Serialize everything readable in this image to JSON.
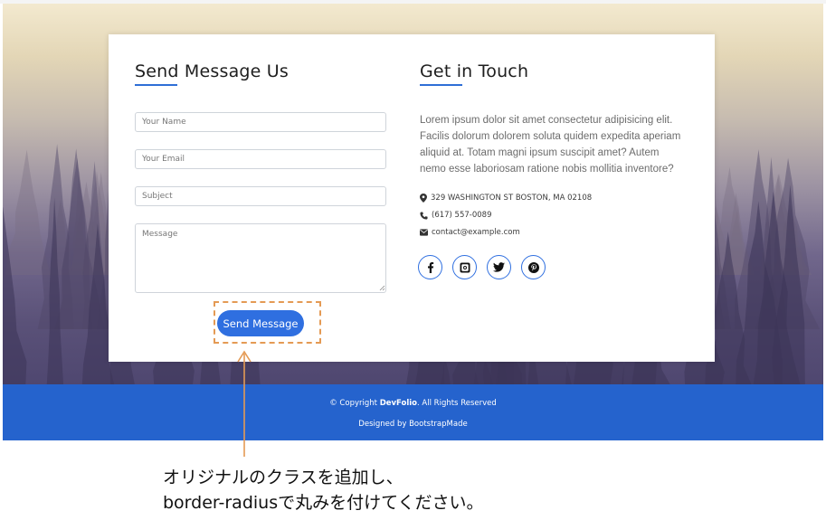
{
  "contact_form": {
    "title": "Send Message Us",
    "name_placeholder": "Your Name",
    "email_placeholder": "Your Email",
    "subject_placeholder": "Subject",
    "message_placeholder": "Message",
    "send_label": "Send Message"
  },
  "get_in_touch": {
    "title": "Get in Touch",
    "description": "Lorem ipsum dolor sit amet consectetur adipisicing elit. Facilis dolorum dolorem soluta quidem expedita aperiam aliquid at. Totam magni ipsum suscipit amet? Autem nemo esse laboriosam ratione nobis mollitia inventore?",
    "address": "329 WASHINGTON ST BOSTON, MA 02108",
    "phone": "(617) 557-0089",
    "email": "contact@example.com",
    "social_icons": [
      "facebook-icon",
      "instagram-icon",
      "twitter-icon",
      "pinterest-icon"
    ]
  },
  "footer": {
    "copyright_prefix": "© Copyright",
    "brand": "DevFolio",
    "copyright_suffix": ". All Rights Reserved",
    "designed_by": "Designed by BootstrapMade"
  },
  "annotation": {
    "line1": "オリジナルのクラスを追加し、",
    "line2": "border-radiusで丸みを付けてください。"
  },
  "colors": {
    "accent": "#2f6fe0",
    "footer_bg": "#2563cd",
    "highlight_outline": "#e49a54"
  }
}
